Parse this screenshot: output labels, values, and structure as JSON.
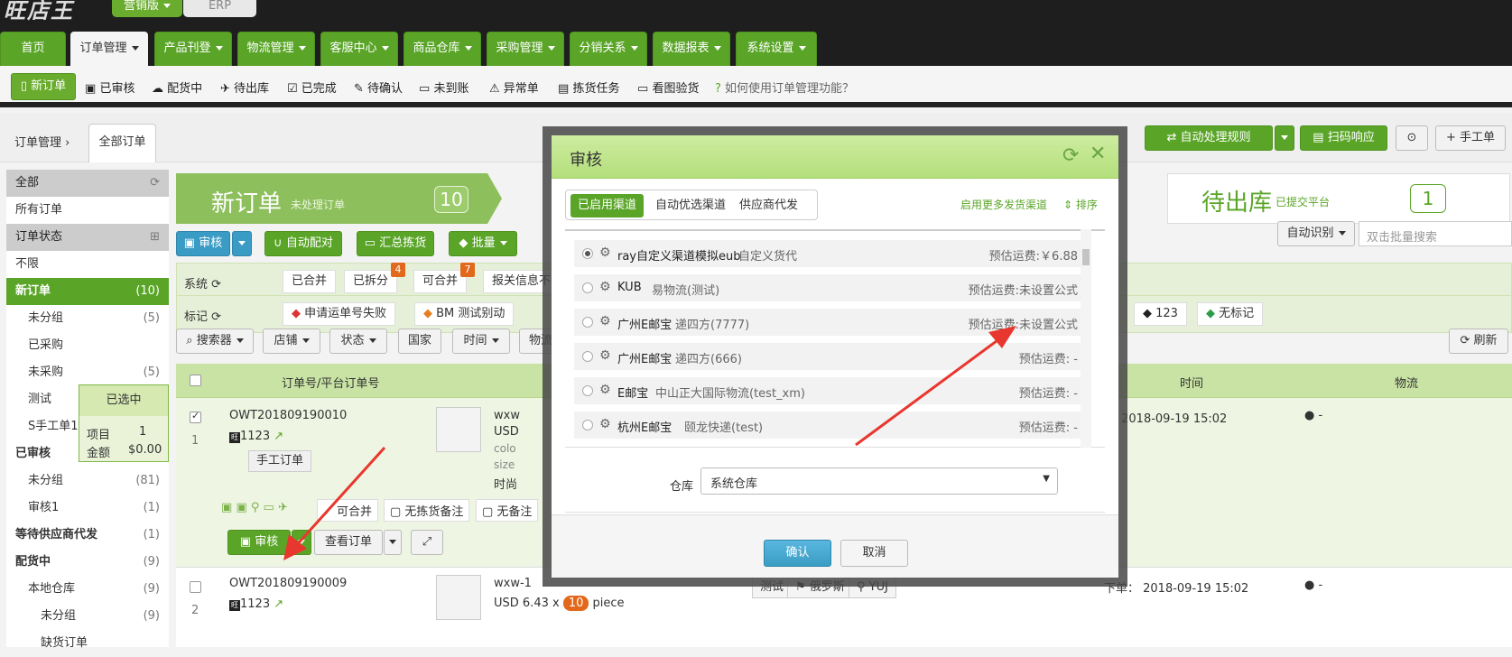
{
  "top": {
    "logo": "旺店王",
    "edition_tabs": [
      "营销版",
      "ERP"
    ]
  },
  "nav": [
    {
      "label": "首页"
    },
    {
      "label": "订单管理"
    },
    {
      "label": "产品刊登"
    },
    {
      "label": "物流管理"
    },
    {
      "label": "客服中心"
    },
    {
      "label": "商品仓库"
    },
    {
      "label": "采购管理"
    },
    {
      "label": "分销关系"
    },
    {
      "label": "数据报表"
    },
    {
      "label": "系统设置"
    }
  ],
  "subnav": [
    "新订单",
    "已审核",
    "配货中",
    "待出库",
    "已完成",
    "待确认",
    "未到账",
    "异常单",
    "拣货任务",
    "看图验货",
    "如何使用订单管理功能？"
  ],
  "breadcrumb": [
    "订单管理",
    "全部订单"
  ],
  "right_toolbar": [
    "自动处理规则",
    "扫码响应",
    "手工单"
  ],
  "sidebar": [
    {
      "label": "全部",
      "type": "head"
    },
    {
      "label": "所有订单"
    },
    {
      "label": "订单状态",
      "type": "head"
    },
    {
      "label": "不限"
    },
    {
      "label": "新订单",
      "count": "(10)",
      "type": "sel"
    },
    {
      "label": "未分组",
      "count": "(5)",
      "type": "sub"
    },
    {
      "label": "已采购",
      "type": "sub"
    },
    {
      "label": "未采购",
      "count": "(5)",
      "type": "sub"
    },
    {
      "label": "测试",
      "type": "sub"
    },
    {
      "label": "S手工单1",
      "type": "sub"
    },
    {
      "label": "已审核",
      "type": "bold"
    },
    {
      "label": "未分组",
      "count": "(81)",
      "type": "sub"
    },
    {
      "label": "审核1",
      "count": "(1)",
      "type": "sub"
    },
    {
      "label": "等待供应商代发",
      "count": "(1)",
      "type": "bold"
    },
    {
      "label": "配货中",
      "count": "(9)",
      "type": "bold"
    },
    {
      "label": "本地仓库",
      "count": "(9)",
      "type": "sub"
    },
    {
      "label": "未分组",
      "count": "(9)",
      "type": "sub2"
    },
    {
      "label": "缺货订单",
      "type": "sub2"
    }
  ],
  "selected_popup": {
    "title": "已选中",
    "item_label": "项目",
    "item_value": "1",
    "amount_label": "金额",
    "amount_value": "$0.00"
  },
  "stages": {
    "new": {
      "title": "新订单",
      "sub": "未处理订单",
      "count": "10"
    },
    "out": {
      "title": "待出库",
      "sub": "已提交平台",
      "count": "1"
    }
  },
  "actions": [
    "审核",
    "自动配对",
    "汇总拣货",
    "批量"
  ],
  "filters": {
    "system_label": "系统",
    "system_tags": [
      {
        "label": "已合并"
      },
      {
        "label": "已拆分",
        "badge": "4"
      },
      {
        "label": "可合并",
        "badge": "7"
      },
      {
        "label": "报关信息不"
      }
    ],
    "mark_label": "标记",
    "mark_tags": [
      "申请运单号失败",
      "BM 测试别动"
    ],
    "mark_tags_right": [
      "123",
      "无标记"
    ],
    "auto_recognize": "自动识别",
    "batch_search_placeholder": "双击批量搜索"
  },
  "search_buttons": [
    "搜索器",
    "店铺",
    "状态",
    "国家",
    "时间",
    "物流"
  ],
  "refresh_label": "刷新",
  "table_headers": {
    "order": "订单号/平台订单号",
    "time": "时间",
    "logistics": "物流"
  },
  "rows": [
    {
      "index": "1",
      "order_no": "OWT201809190010",
      "platform_no": "1123",
      "tag": "手工订单",
      "product": "wxw",
      "price": "USD",
      "attr1": "colo",
      "attr2": "size",
      "attr3": "时尚",
      "time": "下单： 2018-09-19 15:02",
      "logistics": "-",
      "checked": true,
      "status_tags": [
        "可合并",
        "无拣货备注",
        "无备注"
      ],
      "buttons": [
        "审核",
        "查看订单"
      ]
    },
    {
      "index": "2",
      "order_no": "OWT201809190009",
      "platform_no": "1123",
      "product": "wxw-1",
      "price": "USD 6.43 x",
      "qty": "10",
      "unit": "piece",
      "time": "下单： 2018-09-19 15:02",
      "logistics": "-",
      "checked": false,
      "labels": [
        "测试",
        "俄罗斯",
        "YUJ"
      ]
    }
  ],
  "modal": {
    "title": "审核",
    "tabs": [
      "已启用渠道",
      "自动优选渠道",
      "供应商代发"
    ],
    "more_link": "启用更多发货渠道",
    "sort_link": "排序",
    "channels": [
      {
        "name": "ray自定义渠道模拟eub",
        "desc": "自定义货代",
        "fee": "预估运费:￥6.88",
        "selected": true
      },
      {
        "name": "KUB",
        "desc": "易物流(测试)",
        "fee": "预估运费:未设置公式"
      },
      {
        "name": "广州E邮宝",
        "desc": "递四方(7777)",
        "fee": "预估运费:未设置公式"
      },
      {
        "name": "广州E邮宝",
        "desc": "递四方(666)",
        "fee": "预估运费: -"
      },
      {
        "name": "E邮宝",
        "desc": "中山正大国际物流(test_xm)",
        "fee": "预估运费: -"
      },
      {
        "name": "杭州E邮宝",
        "desc": "颐龙快递(test)",
        "fee": "预估运费: -"
      }
    ],
    "warehouse_label": "仓库",
    "warehouse_value": "系统仓库",
    "ok": "确认",
    "cancel": "取消"
  },
  "colors": {
    "brand_green": "#5aa528",
    "accent_blue": "#3a9cc4",
    "badge_orange": "#e2681b",
    "arrow_red": "#e8372e"
  }
}
